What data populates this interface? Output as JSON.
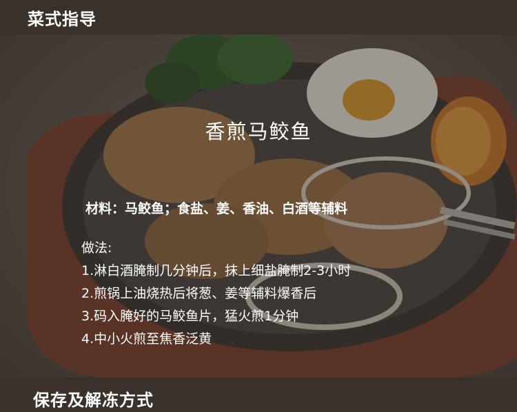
{
  "header": {
    "title": "菜式指导"
  },
  "dish": {
    "title": "香煎马鲛鱼",
    "ingredients": "材料：马鲛鱼；食盐、姜、香油、白酒等辅料",
    "method": {
      "label": "做法:",
      "steps": [
        "1.淋白酒腌制几分钟后，抹上细盐腌制2-3小时",
        "2.煎锅上油烧热后将葱、姜等辅料爆香后",
        "3.码入腌好的马鲛鱼片，猛火煎1分钟",
        "4.中小火煎至焦香泛黄"
      ]
    }
  },
  "footer": {
    "title": "保存及解冻方式"
  },
  "colors": {
    "band": "#3b312b",
    "text": "#ffffff"
  }
}
